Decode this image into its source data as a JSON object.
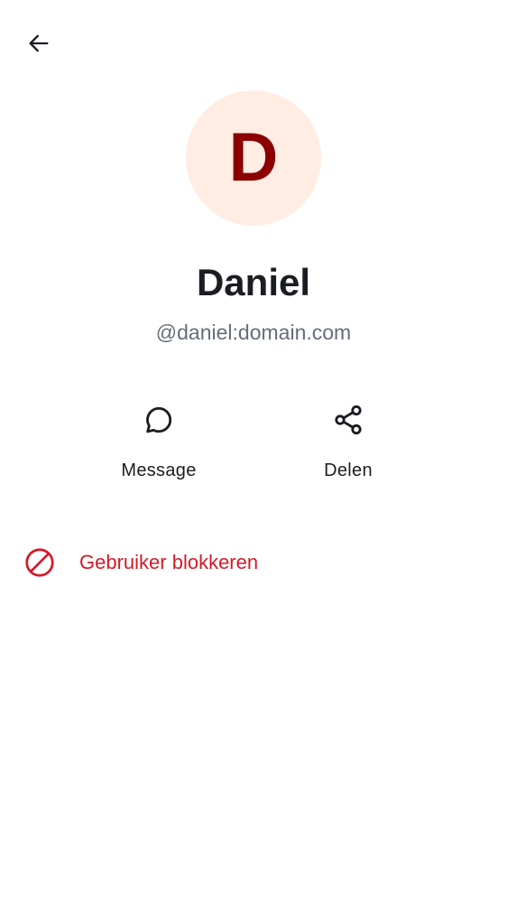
{
  "header": {
    "back_icon": "arrow-left-icon"
  },
  "profile": {
    "avatar_initial": "D",
    "avatar_bg": "#ffede4",
    "avatar_fg": "#8b0000",
    "display_name": "Daniel",
    "user_id": "@daniel:domain.com"
  },
  "actions": [
    {
      "label": "Message",
      "icon": "chat-bubble-icon"
    },
    {
      "label": "Delen",
      "icon": "share-icon"
    }
  ],
  "block": {
    "label": "Gebruiker blokkeren",
    "icon": "block-icon",
    "color": "#d51928"
  }
}
